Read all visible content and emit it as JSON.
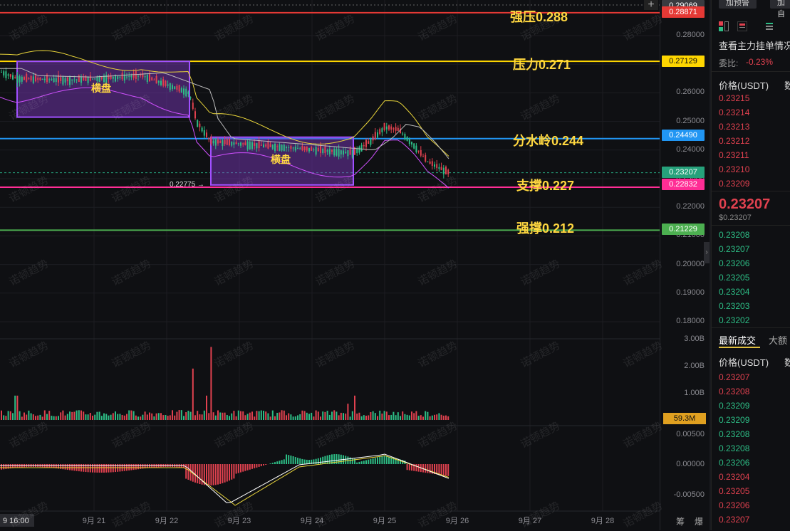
{
  "chart_data": {
    "type": "candlestick",
    "price_axis": [
      "0.28000",
      "0.27000",
      "0.26000",
      "0.25000",
      "0.24000",
      "0.23000",
      "0.22000",
      "0.21000",
      "0.20000",
      "0.19000",
      "0.18000"
    ],
    "volume_axis": [
      "3.00B",
      "2.00B",
      "1.00B"
    ],
    "macd_axis": [
      "0.00500",
      "0.00000",
      "-0.00500"
    ],
    "x_axis": [
      "9月 21",
      "9月 22",
      "9月 23",
      "9月 24",
      "9月 25",
      "9月 26",
      "9月 27",
      "9月 28"
    ],
    "crosshair_time": "9 16:00",
    "levels": [
      {
        "label": "强压0.288",
        "value": 0.288,
        "color": "#e53935"
      },
      {
        "label": "压力0.271",
        "value": 0.271,
        "color": "#ffd600"
      },
      {
        "label": "分水岭0.244",
        "value": 0.244,
        "color": "#2196f3"
      },
      {
        "label": "支撑0.227",
        "value": 0.227,
        "color": "#ff2d95"
      },
      {
        "label": "强撑0.212",
        "value": 0.212,
        "color": "#4caf50"
      }
    ],
    "boxes": [
      {
        "label": "横盘",
        "from": "9月 20",
        "to": "9月 22"
      },
      {
        "label": "横盘",
        "from": "9月 22",
        "to": "9月 24"
      }
    ],
    "low_marker": "0.22775 →",
    "price_tags": [
      {
        "value": "0.29069",
        "bg": "#3a3b40",
        "fg": "#ffffff"
      },
      {
        "value": "0.28871",
        "bg": "#e53935",
        "fg": "#ffffff"
      },
      {
        "value": "0.27129",
        "bg": "#ffd600",
        "fg": "#111111"
      },
      {
        "value": "0.24490",
        "bg": "#2196f3",
        "fg": "#ffffff"
      },
      {
        "value": "0.23207",
        "bg": "#26a17b",
        "fg": "#ffffff"
      },
      {
        "value": "0.22832",
        "bg": "#ff2d95",
        "fg": "#ffffff"
      },
      {
        "value": "0.21229",
        "bg": "#4caf50",
        "fg": "#ffffff"
      }
    ],
    "volume_tag": "59.3M",
    "watermark": "诺顿趋势"
  },
  "toolbar": {
    "plus": "+"
  },
  "bottom_right": {
    "label1": "筹",
    "label2": "爆"
  },
  "book": {
    "btn1": "加预警",
    "btn2": "加自",
    "title": "查看主力挂单情况",
    "ratio_label": "委比:",
    "ratio_value": "-0.23%",
    "price_header": "价格(USDT)",
    "qty_header": "数",
    "asks": [
      "0.23215",
      "0.23214",
      "0.23213",
      "0.23212",
      "0.23211",
      "0.23210",
      "0.23209"
    ],
    "last_price": "0.23207",
    "last_usd": "$0.23207",
    "bids": [
      "0.23208",
      "0.23207",
      "0.23206",
      "0.23205",
      "0.23204",
      "0.23203",
      "0.23202"
    ],
    "trades_tab": "最新成交",
    "trades_tab2": "大额",
    "trades_price_header": "价格(USDT)",
    "trades_qty_header": "数",
    "trades": [
      {
        "p": "0.23207",
        "c": "red"
      },
      {
        "p": "0.23208",
        "c": "red"
      },
      {
        "p": "0.23209",
        "c": "green"
      },
      {
        "p": "0.23209",
        "c": "green"
      },
      {
        "p": "0.23208",
        "c": "green"
      },
      {
        "p": "0.23208",
        "c": "green"
      },
      {
        "p": "0.23206",
        "c": "green"
      },
      {
        "p": "0.23204",
        "c": "red"
      },
      {
        "p": "0.23205",
        "c": "red"
      },
      {
        "p": "0.23206",
        "c": "red"
      },
      {
        "p": "0.23207",
        "c": "red"
      }
    ]
  }
}
